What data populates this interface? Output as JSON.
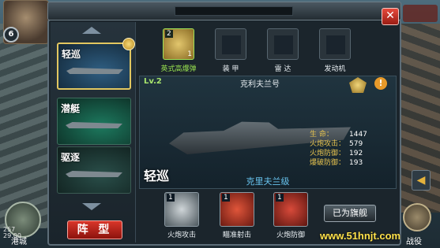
{
  "player": {
    "level": "6"
  },
  "topbar": {
    "close_glyph": "✕"
  },
  "ship_list": {
    "items": [
      {
        "tag": "轻巡",
        "selected": true
      },
      {
        "tag": "潜艇",
        "selected": false
      },
      {
        "tag": "驱逐",
        "selected": false
      }
    ],
    "formation_button": "阵 型"
  },
  "equipment": [
    {
      "label": "英式高爆弹",
      "count_top": "2",
      "count_bottom": "1",
      "active": true,
      "icon": "shell-icon"
    },
    {
      "label": "装 甲",
      "active": false,
      "icon": "armor-icon"
    },
    {
      "label": "雷 达",
      "active": false,
      "icon": "radar-icon"
    },
    {
      "label": "发动机",
      "active": false,
      "icon": "engine-icon"
    }
  ],
  "ship": {
    "level": "Lv.2",
    "name": "克利夫兰号",
    "type_tag": "轻巡",
    "class_name": "克里夫兰级",
    "info_glyph": "!",
    "stats": [
      {
        "label": "生    命：",
        "value": "1447"
      },
      {
        "label": "火炮攻击：",
        "value": "579"
      },
      {
        "label": "火炮防御：",
        "value": "192"
      },
      {
        "label": "爆破防御：",
        "value": "193"
      }
    ]
  },
  "skills": [
    {
      "level": "1",
      "label": "火炮攻击",
      "color": "#cfd5d8",
      "icon": "cannon-icon"
    },
    {
      "level": "1",
      "label": "瞄准射击",
      "color": "#e0553a",
      "icon": "target-icon"
    },
    {
      "level": "1",
      "label": "火炮防御",
      "color": "#d84a3a",
      "icon": "shield-cannon-icon"
    }
  ],
  "flagship_button": "已为旗舰",
  "bottom": {
    "port_label": "港城",
    "battle_label": "战役",
    "side_arrow": "◀",
    "coords_line1": "257",
    "coords_line2": "29 00"
  },
  "watermark": "www.51hnjt.com"
}
